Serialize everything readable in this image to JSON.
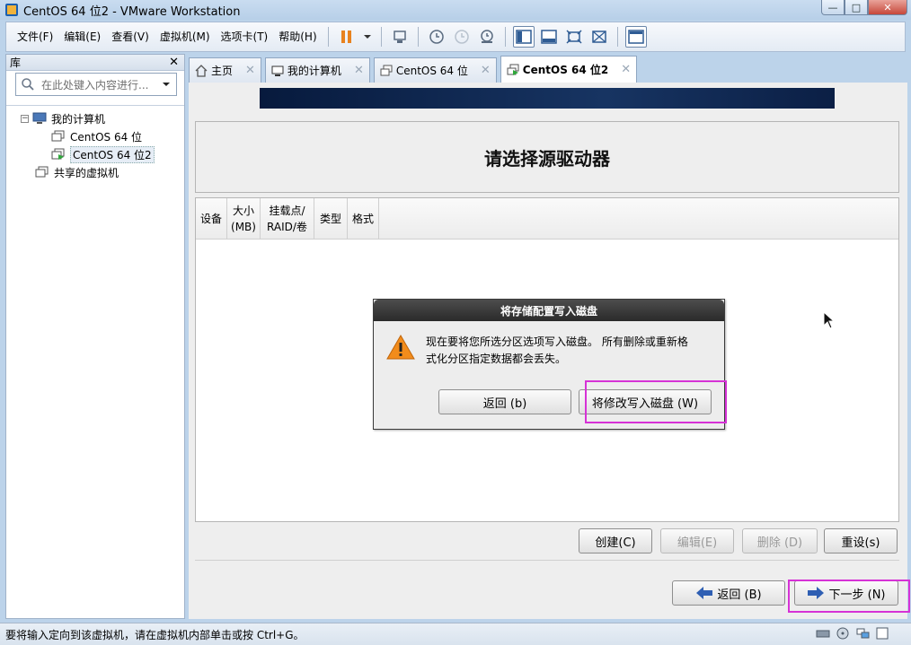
{
  "window": {
    "title": "CentOS 64 位2 - VMware Workstation"
  },
  "menu": {
    "items": [
      "文件(F)",
      "编辑(E)",
      "查看(V)",
      "虚拟机(M)",
      "选项卡(T)",
      "帮助(H)"
    ]
  },
  "library": {
    "title": "库",
    "search_placeholder": "在此处键入内容进行...",
    "tree": {
      "my_computer": "我的计算机",
      "vm1": "CentOS 64 位",
      "vm2": "CentOS 64 位2",
      "shared": "共享的虚拟机"
    }
  },
  "tabs": [
    {
      "label": "主页"
    },
    {
      "label": "我的计算机"
    },
    {
      "label": "CentOS 64 位"
    },
    {
      "label": "CentOS 64 位2"
    }
  ],
  "installer": {
    "heading": "请选择源驱动器",
    "columns": {
      "device": "设备",
      "size_l1": "大小",
      "size_l2": "(MB)",
      "mount_l1": "挂载点/",
      "mount_l2": "RAID/卷",
      "type": "类型",
      "format": "格式"
    },
    "buttons": {
      "create": "创建(C)",
      "edit": "编辑(E)",
      "delete": "删除 (D)",
      "reset": "重设(s)",
      "back": "返回 (B)",
      "next": "下一步 (N)"
    }
  },
  "dialog": {
    "title": "将存储配置写入磁盘",
    "message_l1": "现在要将您所选分区选项写入磁盘。 所有删除或重新格",
    "message_l2": "式化分区指定数据都会丢失。",
    "back_label": "返回 (b)",
    "write_label": "将修改写入磁盘 (W)"
  },
  "statusbar": {
    "text": "要将输入定向到该虚拟机，请在虚拟机内部单击或按 Ctrl+G。"
  },
  "colors": {
    "highlight": "#d632d6",
    "banner": "#173462"
  }
}
